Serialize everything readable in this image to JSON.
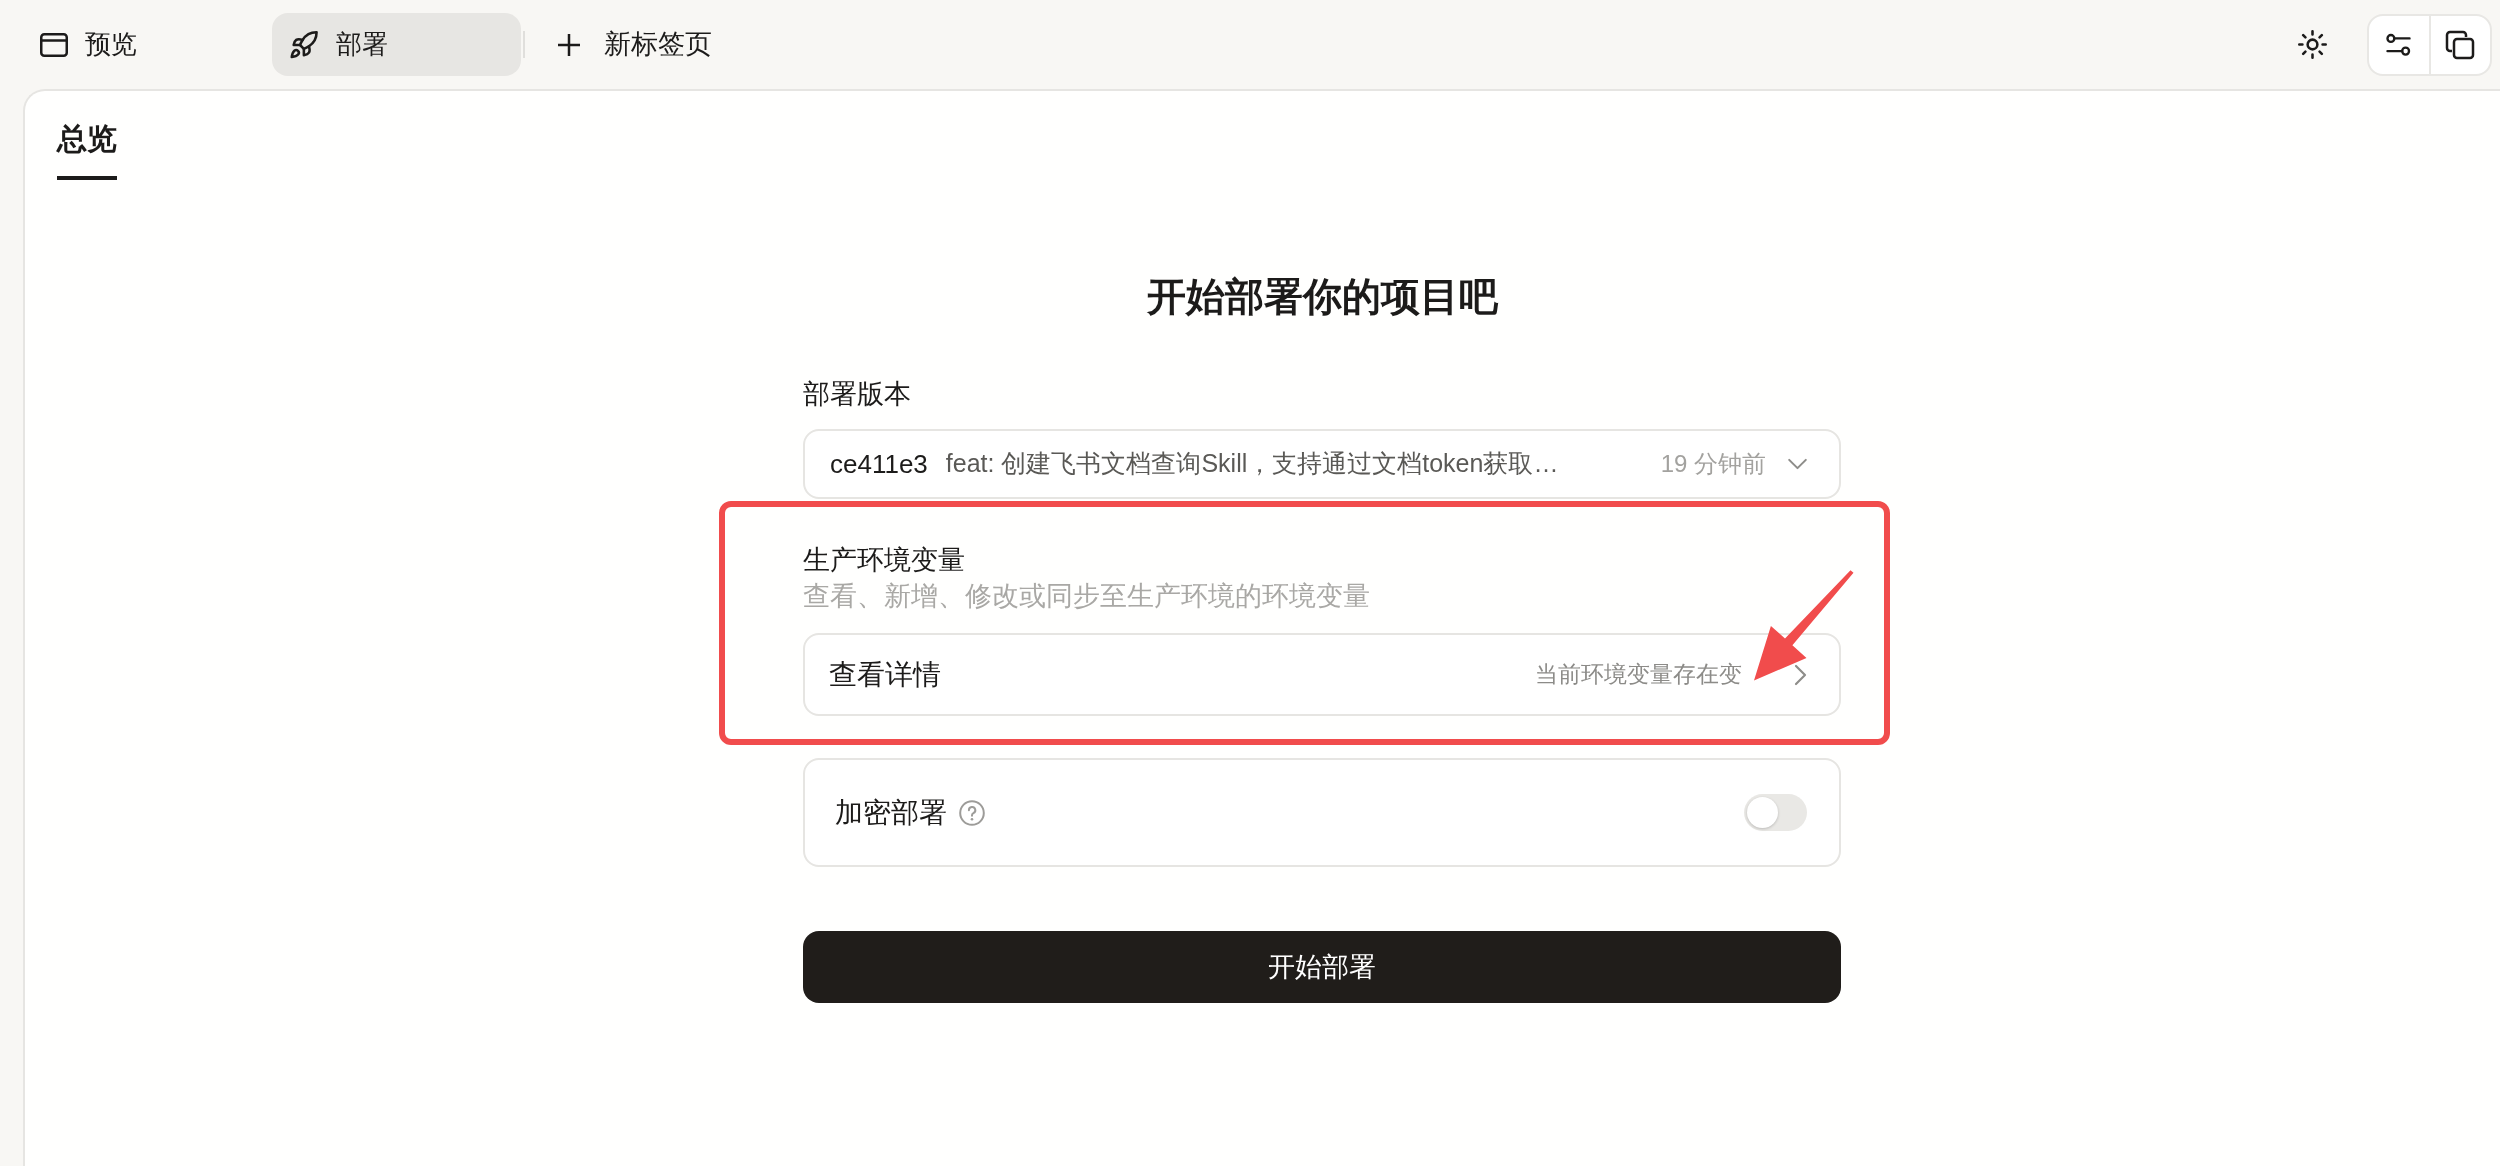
{
  "top_tabs": [
    {
      "kind": "browser",
      "label": "预览",
      "selected": false
    },
    {
      "kind": "rocket",
      "label": "部署",
      "selected": true
    }
  ],
  "new_tab": {
    "label": "新标签页"
  },
  "page_tabs": [
    {
      "label": "总览",
      "selected": true
    }
  ],
  "heading": "开始部署你的项目吧",
  "version": {
    "label": "部署版本",
    "commit": "ce411e3",
    "message": "feat: 创建飞书文档查询Skill，支持通过文档token获取…",
    "time": "19 分钟前"
  },
  "env_vars": {
    "highlighted": true,
    "title": "生产环境变量",
    "description": "查看、新增、修改或同步至生产环境的环境变量",
    "details": {
      "label": "查看详情",
      "status": "当前环境变量存在变",
      "pointer_arrow": true
    }
  },
  "encrypt": {
    "label": "加密部署",
    "on": false
  },
  "deploy_button": {
    "label": "开始部署"
  }
}
